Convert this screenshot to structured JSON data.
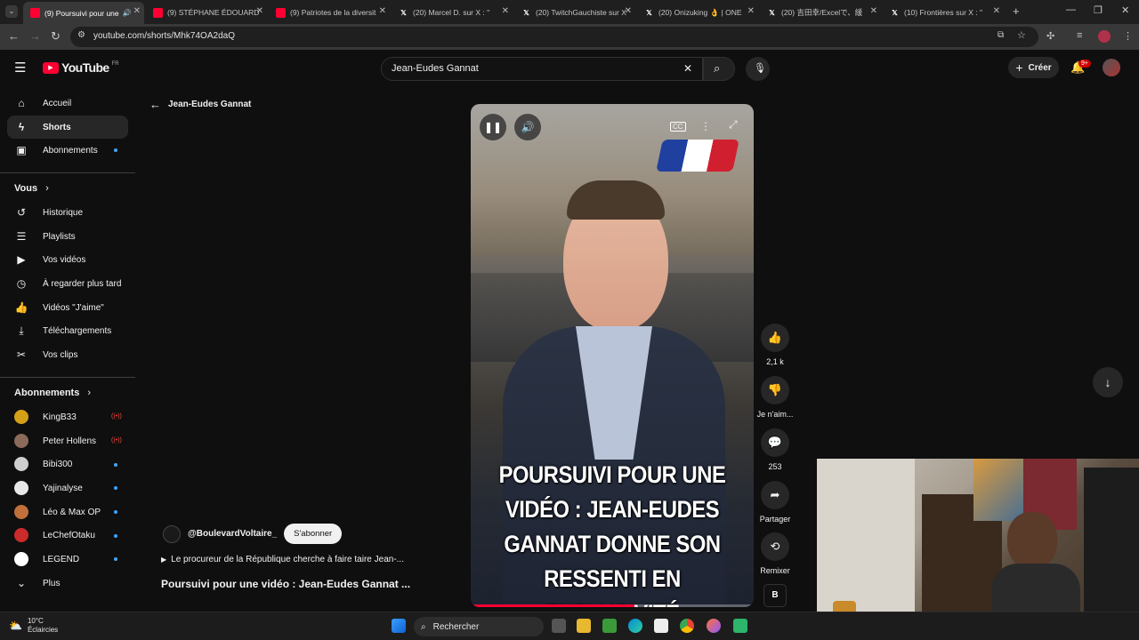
{
  "browser": {
    "tabs": [
      {
        "title": "(9) Poursuivi pour une",
        "favicon": "youtube-icon",
        "active": true
      },
      {
        "title": "(9) STÉPHANE ÉDOUARD",
        "favicon": "youtube-icon"
      },
      {
        "title": "(9) Patriotes de la diversit",
        "favicon": "youtube-icon"
      },
      {
        "title": "(20) Marcel D. sur X : \"",
        "favicon": "x-icon"
      },
      {
        "title": "(20) TwitchGauchiste sur X",
        "favicon": "x-icon"
      },
      {
        "title": "(20) Onizuking 👌 | ONE",
        "favicon": "x-icon"
      },
      {
        "title": "(20) 吉田幸/Excelで、緩",
        "favicon": "x-icon"
      },
      {
        "title": "(10) Frontières sur X : \"",
        "favicon": "x-icon"
      }
    ],
    "url": "youtube.com/shorts/Mhk74OA2daQ"
  },
  "header": {
    "logo_text": "YouTube",
    "region": "FR",
    "search_value": "Jean-Eudes Gannat",
    "create_label": "Créer",
    "notifications_badge": "9+"
  },
  "sidebar": {
    "main": [
      {
        "label": "Accueil",
        "icon": "home-icon"
      },
      {
        "label": "Shorts",
        "icon": "shorts-icon",
        "active": true
      },
      {
        "label": "Abonnements",
        "icon": "subscriptions-icon"
      }
    ],
    "you_heading": "Vous",
    "you_items": [
      {
        "label": "Historique",
        "icon": "history-icon"
      },
      {
        "label": "Playlists",
        "icon": "playlists-icon"
      },
      {
        "label": "Vos vidéos",
        "icon": "your-videos-icon"
      },
      {
        "label": "À regarder plus tard",
        "icon": "watch-later-icon"
      },
      {
        "label": "Vidéos \"J'aime\"",
        "icon": "liked-icon"
      },
      {
        "label": "Téléchargements",
        "icon": "download-icon"
      },
      {
        "label": "Vos clips",
        "icon": "clips-icon"
      }
    ],
    "subs_heading": "Abonnements",
    "subscriptions": [
      {
        "name": "KingB33",
        "status": "live",
        "color": "#d4a017"
      },
      {
        "name": "Peter Hollens",
        "status": "live",
        "color": "#8a6a5a"
      },
      {
        "name": "Bibi300",
        "status": "new",
        "color": "#cfcfcf"
      },
      {
        "name": "Yajinalyse",
        "status": "new",
        "color": "#e8e8e8"
      },
      {
        "name": "Léo & Max OP",
        "status": "new",
        "color": "#c0703a"
      },
      {
        "name": "LeChefOtaku",
        "status": "new",
        "color": "#cc2b2b"
      },
      {
        "name": "LEGEND",
        "status": "new",
        "color": "#ffffff"
      }
    ],
    "more_label": "Plus"
  },
  "shorts": {
    "back_label": "Jean-Eudes Gannat",
    "caption": "POURSUIVI POUR UNE VIDÉO : JEAN-EUDES GANNAT DONNE SON RESSENTI EN EXCLUSIVITÉ",
    "progress": 0.58,
    "likes": "2,1 k",
    "dislike_label": "Je n'aim...",
    "comments": "253",
    "share_label": "Partager",
    "remix_label": "Remixer",
    "channel": "@BoulevardVoltaire_",
    "subscribe_label": "S'abonner",
    "description": "Le procureur de la République cherche à faire taire Jean-...",
    "title": "Poursuivi pour une vidéo : Jean-Eudes Gannat ...",
    "brand_color": "#ff0033"
  },
  "taskbar": {
    "temperature": "10°C",
    "weather": "Éclaircies",
    "search_label": "Rechercher"
  }
}
